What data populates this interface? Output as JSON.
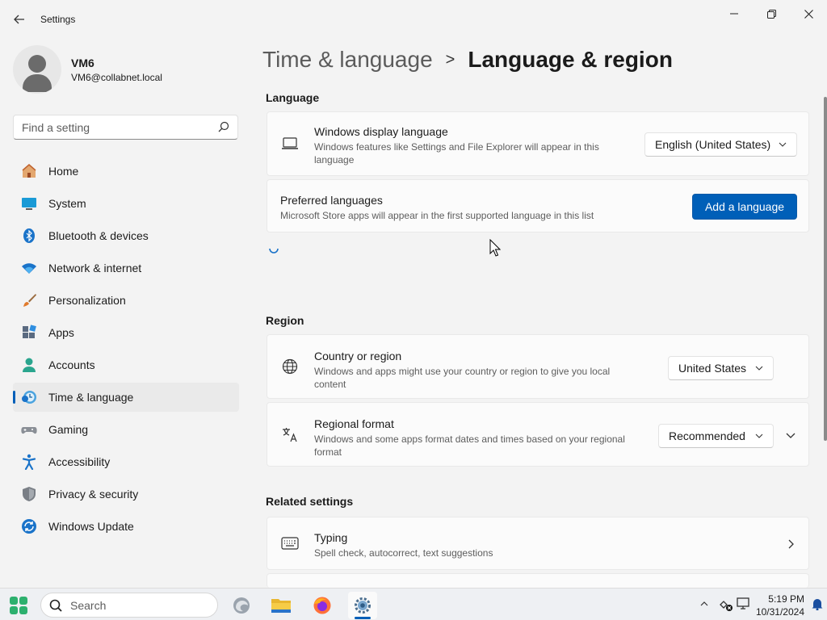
{
  "window": {
    "title": "Settings"
  },
  "profile": {
    "name": "VM6",
    "email": "VM6@collabnet.local"
  },
  "search": {
    "placeholder": "Find a setting"
  },
  "nav": {
    "items": [
      {
        "label": "Home",
        "icon": "home-icon"
      },
      {
        "label": "System",
        "icon": "system-icon"
      },
      {
        "label": "Bluetooth & devices",
        "icon": "bluetooth-icon"
      },
      {
        "label": "Network & internet",
        "icon": "wifi-icon"
      },
      {
        "label": "Personalization",
        "icon": "brush-icon"
      },
      {
        "label": "Apps",
        "icon": "apps-icon"
      },
      {
        "label": "Accounts",
        "icon": "accounts-icon"
      },
      {
        "label": "Time & language",
        "icon": "time-language-icon",
        "active": true
      },
      {
        "label": "Gaming",
        "icon": "gaming-icon"
      },
      {
        "label": "Accessibility",
        "icon": "accessibility-icon"
      },
      {
        "label": "Privacy & security",
        "icon": "shield-icon"
      },
      {
        "label": "Windows Update",
        "icon": "update-icon"
      }
    ]
  },
  "breadcrumb": {
    "parent": "Time & language",
    "separator": ">",
    "current": "Language & region"
  },
  "language_section": {
    "title": "Language",
    "display_language": {
      "title": "Windows display language",
      "description": "Windows features like Settings and File Explorer will appear in this language",
      "value": "English (United States)"
    },
    "preferred_languages": {
      "title": "Preferred languages",
      "description": "Microsoft Store apps will appear in the first supported language in this list",
      "button": "Add a language"
    }
  },
  "region_section": {
    "title": "Region",
    "country": {
      "title": "Country or region",
      "description": "Windows and apps might use your country or region to give you local content",
      "value": "United States"
    },
    "regional_format": {
      "title": "Regional format",
      "description": "Windows and some apps format dates and times based on your regional format",
      "value": "Recommended"
    }
  },
  "related_section": {
    "title": "Related settings",
    "typing": {
      "title": "Typing",
      "description": "Spell check, autocorrect, text suggestions"
    }
  },
  "taskbar": {
    "search_label": "Search",
    "time": "5:19 PM",
    "date": "10/31/2024"
  },
  "colors": {
    "accent": "#005fb8",
    "background": "#f3f3f3",
    "card": "#fbfbfb"
  }
}
